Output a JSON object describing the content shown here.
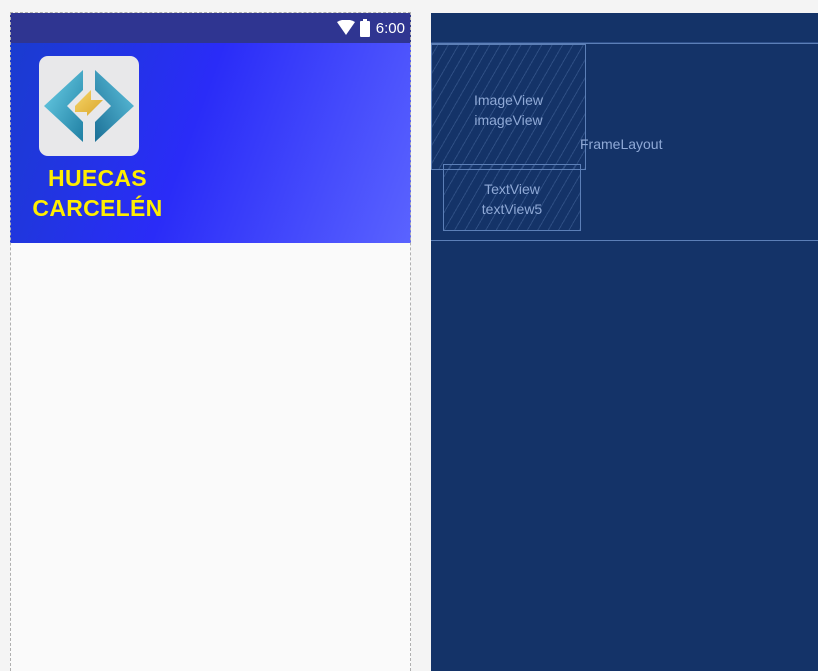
{
  "status_bar": {
    "time": "6:00",
    "icons": [
      "wifi-icon",
      "battery-icon"
    ]
  },
  "header": {
    "title_line1": "HUECAS",
    "title_line2": "CARCELÉN",
    "logo_icon": "app-logo-icon",
    "title_color": "#ffee00",
    "gradient_colors": [
      "#1a3ccf",
      "#2a2cf8",
      "#5a63ff"
    ]
  },
  "blueprint": {
    "background": "#143368",
    "framelayout_label": "FrameLayout",
    "imageview": {
      "type": "ImageView",
      "id": "imageView"
    },
    "textview": {
      "type": "TextView",
      "id": "textView5"
    }
  }
}
